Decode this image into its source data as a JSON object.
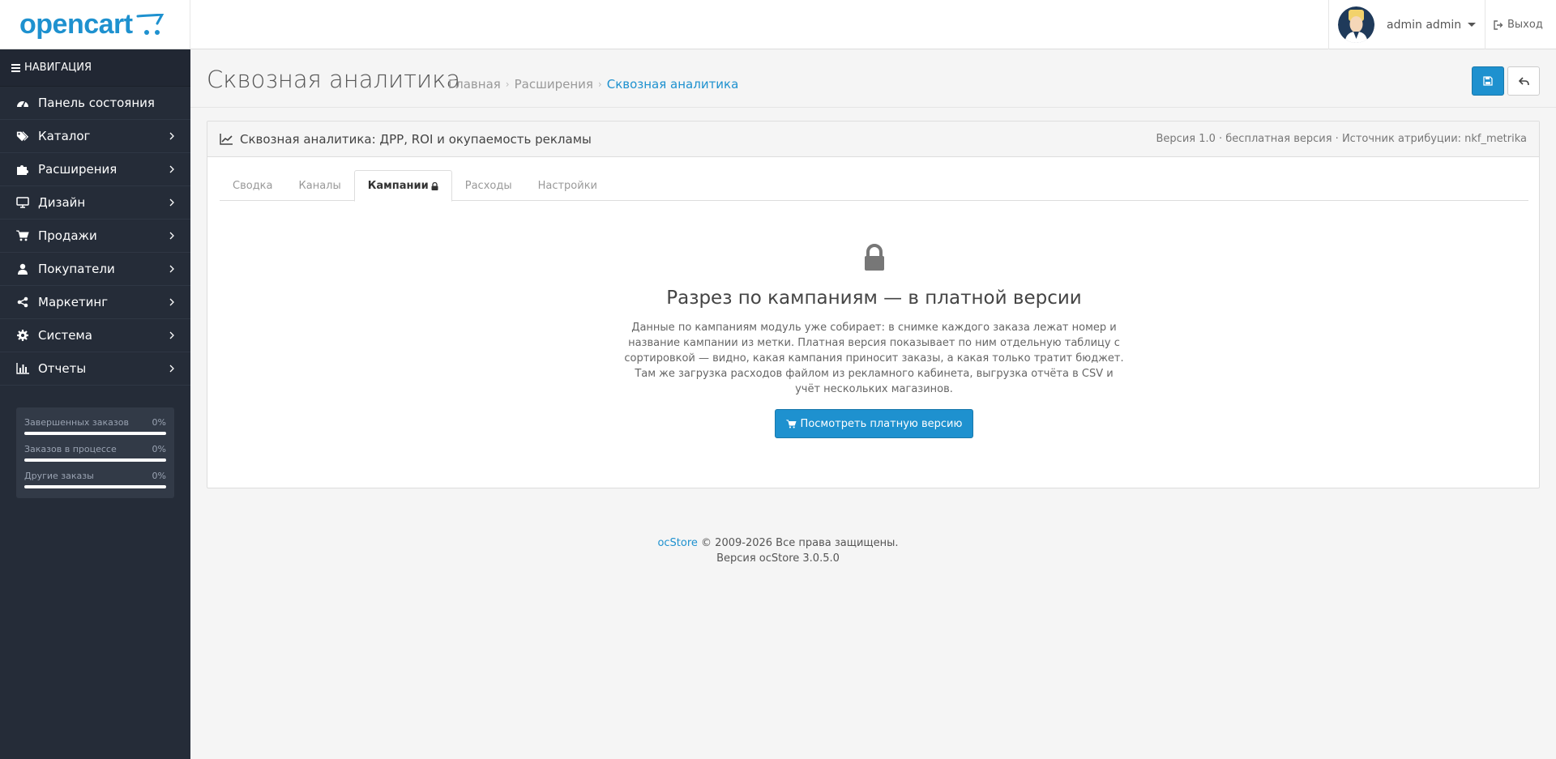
{
  "header": {
    "logo": "opencart",
    "user_name": "admin admin",
    "logout_label": "Выход"
  },
  "sidebar": {
    "title": "НАВИГАЦИЯ",
    "items": [
      {
        "label": "Панель состояния",
        "icon": "dashboard-icon",
        "has_children": false
      },
      {
        "label": "Каталог",
        "icon": "tags-icon",
        "has_children": true
      },
      {
        "label": "Расширения",
        "icon": "puzzle-icon",
        "has_children": true
      },
      {
        "label": "Дизайн",
        "icon": "monitor-icon",
        "has_children": true
      },
      {
        "label": "Продажи",
        "icon": "cart-icon",
        "has_children": true
      },
      {
        "label": "Покупатели",
        "icon": "user-icon",
        "has_children": true
      },
      {
        "label": "Маркетинг",
        "icon": "share-icon",
        "has_children": true
      },
      {
        "label": "Система",
        "icon": "cog-icon",
        "has_children": true
      },
      {
        "label": "Отчеты",
        "icon": "bar-chart-icon",
        "has_children": true
      }
    ],
    "stats": [
      {
        "label": "Завершенных заказов",
        "value": "0%",
        "progress": 0
      },
      {
        "label": "Заказов в процессе",
        "value": "0%",
        "progress": 0
      },
      {
        "label": "Другие заказы",
        "value": "0%",
        "progress": 0
      }
    ]
  },
  "page": {
    "title": "Сквозная аналитика",
    "breadcrumb": [
      "Главная",
      "Расширения",
      "Сквозная аналитика"
    ]
  },
  "panel": {
    "title": "Сквозная аналитика: ДРР, ROI и окупаемость рекламы",
    "meta": "Версия 1.0 · бесплатная версия · Источник атрибуции: nkf_metrika",
    "tabs": [
      "Сводка",
      "Каналы",
      "Кампании",
      "Расходы",
      "Настройки"
    ],
    "active_tab": "Кампании"
  },
  "locked": {
    "heading": "Разрез по кампаниям — в платной версии",
    "text": "Данные по кампаниям модуль уже собирает: в снимке каждого заказа лежат номер и название кампании из метки. Платная версия показывает по ним отдельную таблицу с сортировкой — видно, какая кампания приносит заказы, а какая только тратит бюджет. Там же загрузка расходов файлом из рекламного кабинета, выгрузка отчёта в CSV и учёт нескольких магазинов.",
    "button": "Посмотреть платную версию"
  },
  "footer": {
    "brand": "ocStore",
    "copyright": "© 2009-2026 Все права защищены.",
    "version": "Версия ocStore 3.0.5.0"
  },
  "colors": {
    "accent": "#1e91cf",
    "sidebar_bg": "#252c38"
  }
}
